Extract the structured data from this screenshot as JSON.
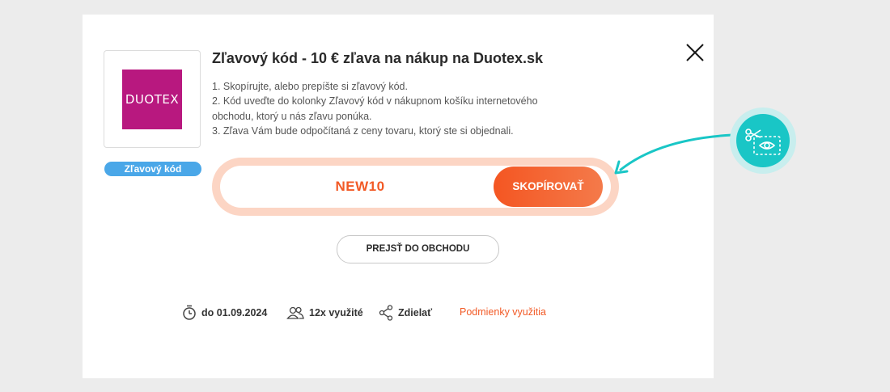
{
  "dialog": {
    "title": "Zľavový kód - 10 € zľava na nákup na Duotex.sk",
    "steps": [
      "1. Skopírujte, alebo prepíšte si zľavový kód.",
      "2. Kód uveďte do kolonky Zľavový kód v nákupnom košíku internetového",
      "obchodu, ktorý u nás zľavu ponúka.",
      "3. Zľava Vám bude odpočítaná z ceny tovaru, ktorý ste si objednali."
    ],
    "badge": "Zľavový kód",
    "logo_text": "DUOTEX",
    "code": "NEW10",
    "copy_label": "SKOPÍROVAŤ",
    "shop_button": "PREJSŤ DO OBCHODU",
    "meta": {
      "expiry": "do 01.09.2024",
      "uses": "12x využité",
      "share": "Zdielať",
      "terms": "Podmienky využitia"
    },
    "icons": {
      "close": "close-icon",
      "timer": "timer-icon",
      "users": "users-icon",
      "share": "share-icon",
      "coupon_hint": "scissors-coupon-icon"
    },
    "colors": {
      "accent": "#f25a26",
      "badge": "#4aa7e8",
      "logo_bg": "#b8187f",
      "teal": "#19c6c6"
    }
  }
}
